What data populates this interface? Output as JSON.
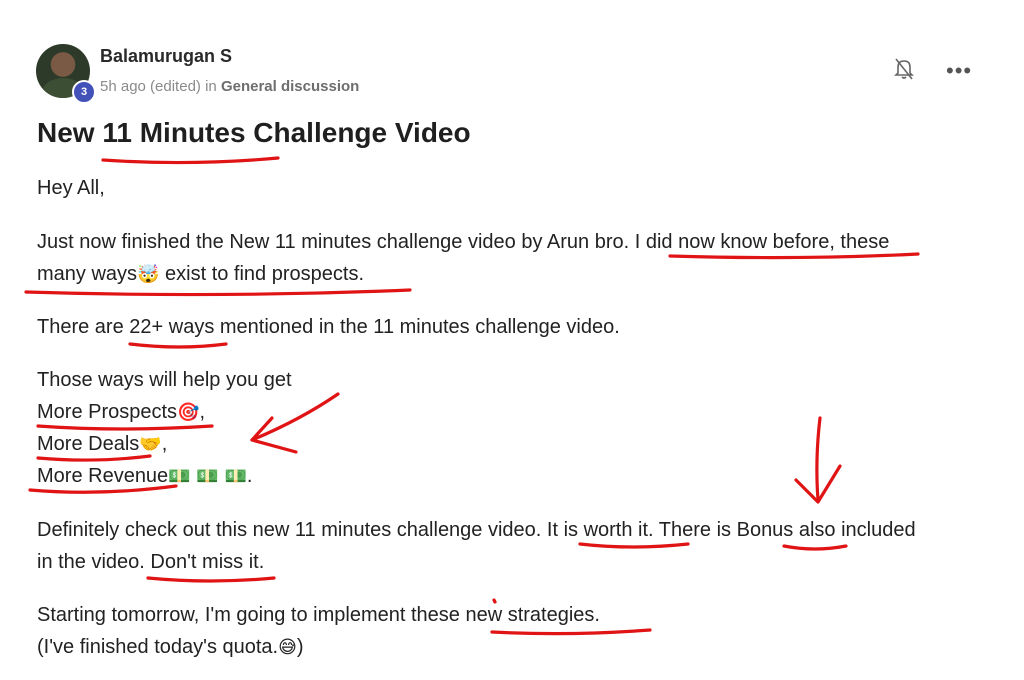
{
  "post": {
    "author": "Balamurugan S",
    "level": "3",
    "time": "5h ago (edited)",
    "in_label": "in",
    "category": "General discussion",
    "title": "New 11 Minutes Challenge Video"
  },
  "body": {
    "greeting": "Hey All,",
    "p1_line1": "Just now finished the New 11 minutes challenge video by Arun bro. I did now know before, these",
    "p1_line2a": "many ways",
    "p1_line2b": " exist to find prospects.",
    "p2": "There are 22+ ways mentioned in the 11 minutes challenge video.",
    "p3_intro": "Those ways will help you get",
    "item1": "More Prospects",
    "item1_end": ",",
    "item2": "More Deals",
    "item2_end": ",",
    "item3": "More Revenue",
    "item3_end": ".",
    "p4_line1": "Definitely check out this new 11 minutes challenge video. It is worth it. There is Bonus also included",
    "p4_line2": "in the video. Don't miss it.",
    "p5_line1": "Starting tomorrow, I'm going to implement these new strategies.",
    "p5_line2a": "(I've finished today's quota.",
    "p5_line2b": ")"
  },
  "emojis": {
    "exploding_head": "🤯",
    "target": "🎯",
    "handshake": "🤝",
    "money": "💵 💵 💵",
    "smiling_sweat": "😅"
  },
  "icons": [
    "bell-off-icon",
    "more-icon",
    "avatar"
  ]
}
